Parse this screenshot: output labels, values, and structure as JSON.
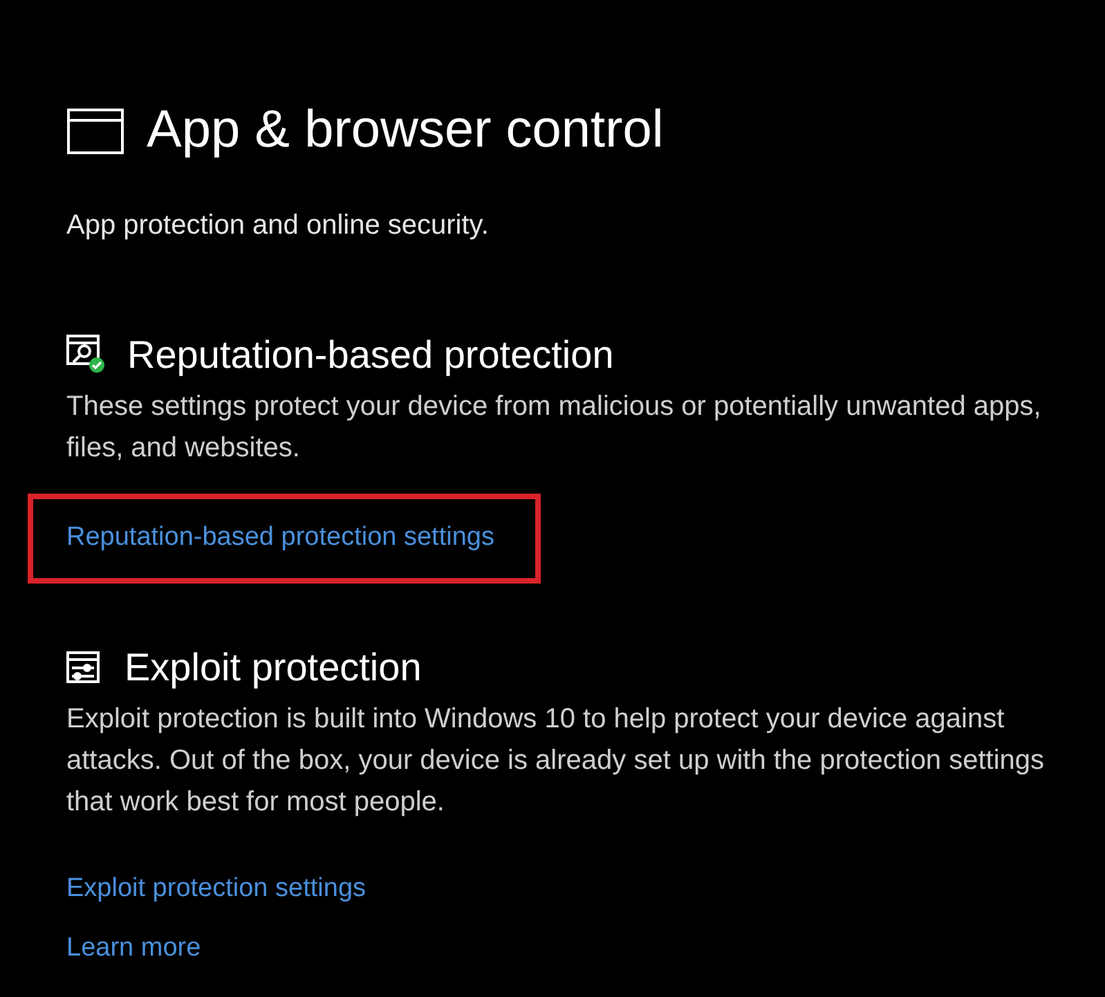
{
  "page": {
    "title": "App & browser control",
    "subtitle": "App protection and online security."
  },
  "sections": [
    {
      "kind": "reputation",
      "heading": "Reputation-based protection",
      "description": "These settings protect your device from malicious or potentially unwanted apps, files, and websites.",
      "links": [
        {
          "label": "Reputation-based protection settings",
          "highlighted": true
        }
      ]
    },
    {
      "kind": "exploit",
      "heading": "Exploit protection",
      "description": "Exploit protection is built into Windows 10 to help protect your device against attacks.  Out of the box, your device is already set up with the protection settings that work best for most people.",
      "links": [
        {
          "label": "Exploit protection settings",
          "highlighted": false
        },
        {
          "label": "Learn more",
          "highlighted": false
        }
      ]
    }
  ]
}
